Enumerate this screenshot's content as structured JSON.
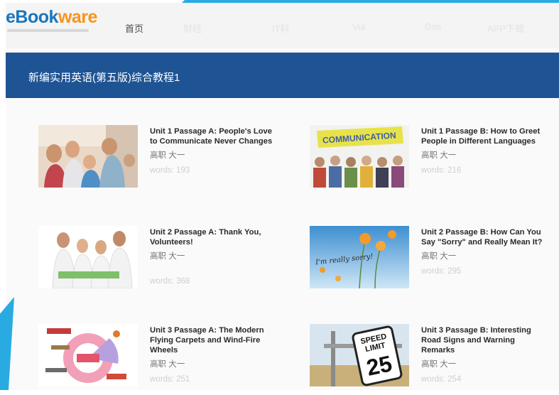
{
  "header": {
    "logo": {
      "e": "e",
      "book": "Book",
      "ware": "ware"
    },
    "nav": [
      "首页",
      "财经",
      "IT科",
      "Vul",
      "Gits",
      "APP下载"
    ]
  },
  "banner": {
    "title": "新编实用英语(第五版)综合教程1"
  },
  "cards": [
    {
      "title": "Unit 1 Passage A: People's Love to Communicate Never Changes",
      "author": "高职 大一",
      "words": "words: 193"
    },
    {
      "title": "Unit 1 Passage B: How to Greet People in Different Languages",
      "author": "高职 大一",
      "words": "words: 216",
      "image_text": "COMMUNICATION"
    },
    {
      "title": "Unit 2 Passage A: Thank You, Volunteers!",
      "author": "高职 大一",
      "words": "words: 368"
    },
    {
      "title": "Unit 2 Passage B: How Can You Say \"Sorry\" and Really Mean It?",
      "author": "高职 大一",
      "words": "words: 295",
      "image_text": "I'm really sorry!"
    },
    {
      "title": "Unit 3 Passage A: The Modern Flying Carpets and Wind-Fire Wheels",
      "author": "高职 大一",
      "words": "words: 251"
    },
    {
      "title": "Unit 3 Passage B: Interesting Road Signs and Warning Remarks",
      "author": "高职 大一",
      "words": "words: 254",
      "image_text": {
        "l1": "SPEED",
        "l2": "LIMIT",
        "num": "25"
      }
    }
  ],
  "colors": {
    "banner": "#1e5494",
    "accent": "#29abe2",
    "logo_blue": "#1b75bb",
    "logo_orange": "#f7941d"
  }
}
